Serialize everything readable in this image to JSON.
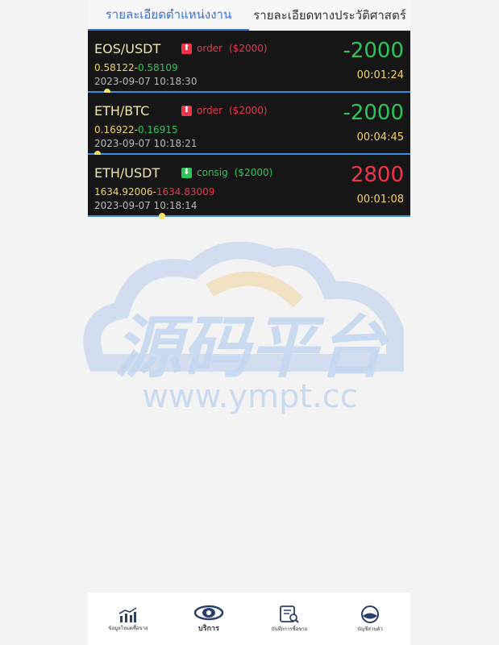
{
  "tabs": [
    {
      "label": "รายละเอียดตำแหน่งงาน",
      "active": true
    },
    {
      "label": "รายละเอียดทางประวัติศาสตร์",
      "active": false
    }
  ],
  "orders": [
    {
      "pair": "EOS/USDT",
      "direction": "up",
      "type": "order",
      "amount": "($2000)",
      "open": "0.58122",
      "sep": "-",
      "current": "0.58109",
      "current_color": "green",
      "time": "2023-09-07 10:18:30",
      "pnl": "-2000",
      "pnl_sign": "neg",
      "duration": "00:01:24",
      "progress": 0.06
    },
    {
      "pair": "ETH/BTC",
      "direction": "up",
      "type": "order",
      "amount": "($2000)",
      "open": "0.16922",
      "sep": "-",
      "current": "0.16915",
      "current_color": "green",
      "time": "2023-09-07 10:18:21",
      "pnl": "-2000",
      "pnl_sign": "neg",
      "duration": "00:04:45",
      "progress": 0.03
    },
    {
      "pair": "ETH/USDT",
      "direction": "down",
      "type": "consig",
      "amount": "($2000)",
      "open": "1634.92006",
      "sep": "-",
      "current": "1634.83009",
      "current_color": "red",
      "time": "2023-09-07 10:18:14",
      "pnl": "2800",
      "pnl_sign": "pos",
      "duration": "00:01:08",
      "progress": 0.23
    }
  ],
  "watermark": {
    "cn": "源码平台",
    "url": "www.ympt.cc"
  },
  "nav": [
    {
      "label": "ข้อมูลโหมดซื้อขาย",
      "icon": "chart-bar-icon"
    },
    {
      "label": "บริการ",
      "icon": "service-eye-icon"
    },
    {
      "label": "บันทึกการซื้อขาย",
      "icon": "document-search-icon"
    },
    {
      "label": "บัญชีส่วนตัว",
      "icon": "account-globe-icon"
    }
  ]
}
